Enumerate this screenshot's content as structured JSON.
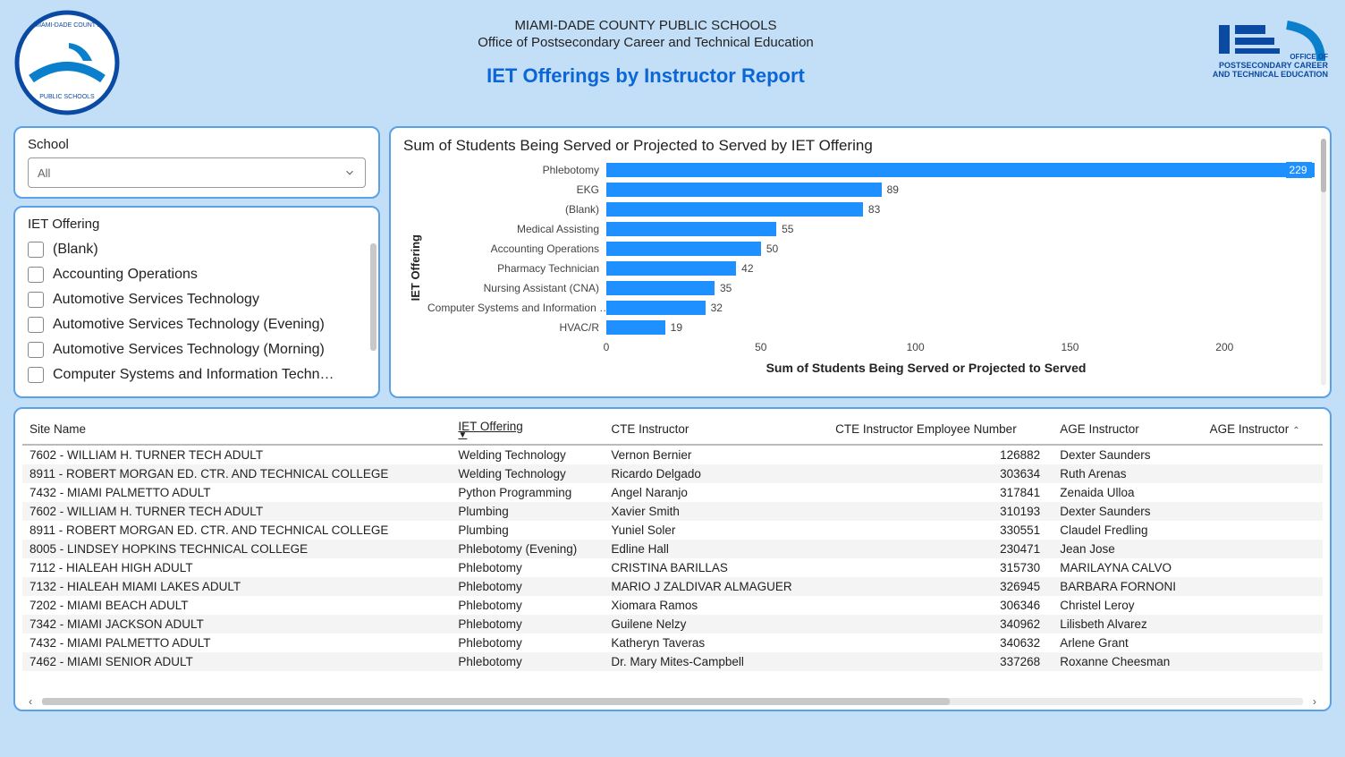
{
  "header": {
    "org_line1": "MIAMI-DADE COUNTY PUBLIC SCHOOLS",
    "org_line2": "Office of Postsecondary Career and Technical Education",
    "report_title": "IET Offerings by Instructor Report",
    "right_logo_line1": "OFFICE OF",
    "right_logo_line2": "POSTSECONDARY CAREER",
    "right_logo_line3": "ANDTECHNICAL EDUCATION"
  },
  "filters": {
    "school_label": "School",
    "school_value": "All",
    "iet_label": "IET Offering",
    "options": [
      "(Blank)",
      "Accounting Operations",
      "Automotive Services Technology",
      "Automotive Services Technology (Evening)",
      "Automotive Services Technology (Morning)",
      "Computer Systems and Information Techn…"
    ]
  },
  "chart_data": {
    "type": "bar",
    "orientation": "horizontal",
    "title": "Sum of Students Being Served or Projected to Served by IET Offering",
    "ylabel": "IET Offering",
    "xlabel": "Sum of Students Being Served or Projected to Served",
    "xlim": [
      0,
      230
    ],
    "xticks": [
      0,
      50,
      100,
      150,
      200
    ],
    "categories": [
      "Phlebotomy",
      "EKG",
      "(Blank)",
      "Medical Assisting",
      "Accounting Operations",
      "Pharmacy Technician",
      "Nursing Assistant (CNA)",
      "Computer Systems and Information …",
      "HVAC/R"
    ],
    "values": [
      229,
      89,
      83,
      55,
      50,
      42,
      35,
      32,
      19
    ],
    "highlight_index": 0
  },
  "table": {
    "columns": [
      "Site Name",
      "IET Offering",
      "CTE Instructor",
      "CTE Instructor Employee Number",
      "AGE Instructor",
      "AGE Instructor"
    ],
    "sort_column_index": 1,
    "sort_direction": "desc",
    "rows": [
      {
        "site": "7602 - WILLIAM H. TURNER TECH ADULT",
        "iet": "Welding Technology",
        "cte": "Vernon Bernier",
        "emp": "126882",
        "age": "Dexter Saunders"
      },
      {
        "site": "8911 - ROBERT MORGAN ED. CTR. AND TECHNICAL COLLEGE",
        "iet": "Welding Technology",
        "cte": "Ricardo Delgado",
        "emp": "303634",
        "age": "Ruth Arenas"
      },
      {
        "site": "7432 - MIAMI PALMETTO ADULT",
        "iet": "Python Programming",
        "cte": "Angel Naranjo",
        "emp": "317841",
        "age": "Zenaida Ulloa"
      },
      {
        "site": "7602 - WILLIAM H. TURNER TECH ADULT",
        "iet": "Plumbing",
        "cte": "Xavier Smith",
        "emp": "310193",
        "age": "Dexter Saunders"
      },
      {
        "site": "8911 - ROBERT MORGAN ED. CTR. AND TECHNICAL COLLEGE",
        "iet": "Plumbing",
        "cte": "Yuniel Soler",
        "emp": "330551",
        "age": "Claudel Fredling"
      },
      {
        "site": "8005 - LINDSEY HOPKINS TECHNICAL COLLEGE",
        "iet": "Phlebotomy (Evening)",
        "cte": "Edline Hall",
        "emp": "230471",
        "age": "Jean Jose"
      },
      {
        "site": "7112 - HIALEAH HIGH ADULT",
        "iet": "Phlebotomy",
        "cte": "CRISTINA BARILLAS",
        "emp": "315730",
        "age": "MARILAYNA CALVO"
      },
      {
        "site": "7132 - HIALEAH MIAMI LAKES ADULT",
        "iet": "Phlebotomy",
        "cte": "MARIO J ZALDIVAR ALMAGUER",
        "emp": "326945",
        "age": "BARBARA FORNONI"
      },
      {
        "site": "7202 - MIAMI BEACH ADULT",
        "iet": "Phlebotomy",
        "cte": "Xiomara Ramos",
        "emp": "306346",
        "age": "Christel Leroy"
      },
      {
        "site": "7342 - MIAMI JACKSON ADULT",
        "iet": "Phlebotomy",
        "cte": "Guilene Nelzy",
        "emp": "340962",
        "age": "Lilisbeth Alvarez"
      },
      {
        "site": "7432 - MIAMI PALMETTO ADULT",
        "iet": "Phlebotomy",
        "cte": "Katheryn Taveras",
        "emp": "340632",
        "age": "Arlene Grant"
      },
      {
        "site": "7462 - MIAMI SENIOR ADULT",
        "iet": "Phlebotomy",
        "cte": "Dr. Mary Mites-Campbell",
        "emp": "337268",
        "age": "Roxanne Cheesman"
      }
    ]
  }
}
